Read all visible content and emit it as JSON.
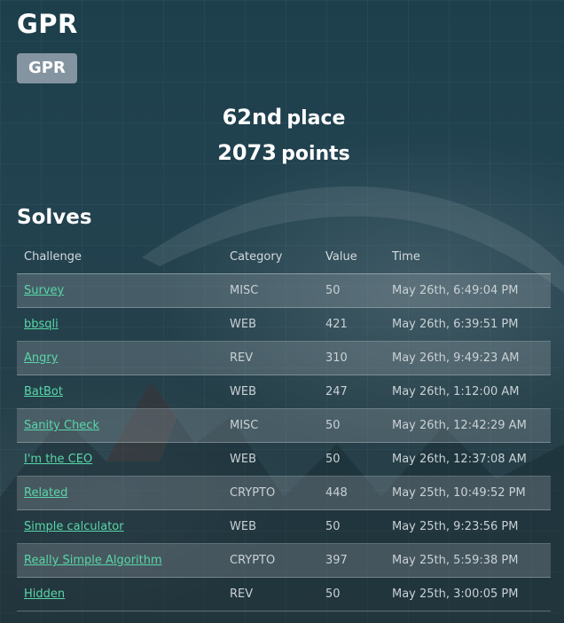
{
  "team": {
    "name": "GPR",
    "badge": "GPR"
  },
  "stats": {
    "place_number": "62nd",
    "place_word": "place",
    "points_number": "2073",
    "points_word": "points"
  },
  "solves": {
    "heading": "Solves",
    "columns": [
      "Challenge",
      "Category",
      "Value",
      "Time"
    ],
    "rows": [
      {
        "challenge": "Survey",
        "category": "MISC",
        "value": "50",
        "time": "May 26th, 6:49:04 PM"
      },
      {
        "challenge": "bbsqli",
        "category": "WEB",
        "value": "421",
        "time": "May 26th, 6:39:51 PM"
      },
      {
        "challenge": "Angry",
        "category": "REV",
        "value": "310",
        "time": "May 26th, 9:49:23 AM"
      },
      {
        "challenge": "BatBot",
        "category": "WEB",
        "value": "247",
        "time": "May 26th, 1:12:00 AM"
      },
      {
        "challenge": "Sanity Check",
        "category": "MISC",
        "value": "50",
        "time": "May 26th, 12:42:29 AM"
      },
      {
        "challenge": "I'm the CEO",
        "category": "WEB",
        "value": "50",
        "time": "May 26th, 12:37:08 AM"
      },
      {
        "challenge": "Related",
        "category": "CRYPTO",
        "value": "448",
        "time": "May 25th, 10:49:52 PM"
      },
      {
        "challenge": "Simple calculator",
        "category": "WEB",
        "value": "50",
        "time": "May 25th, 9:23:56 PM"
      },
      {
        "challenge": "Really Simple Algorithm",
        "category": "CRYPTO",
        "value": "397",
        "time": "May 25th, 5:59:38 PM"
      },
      {
        "challenge": "Hidden",
        "category": "REV",
        "value": "50",
        "time": "May 25th, 3:00:05 PM"
      }
    ]
  },
  "colors": {
    "link": "#58d7a8",
    "badge_bg": "#8494a0",
    "background": "#22424f"
  }
}
